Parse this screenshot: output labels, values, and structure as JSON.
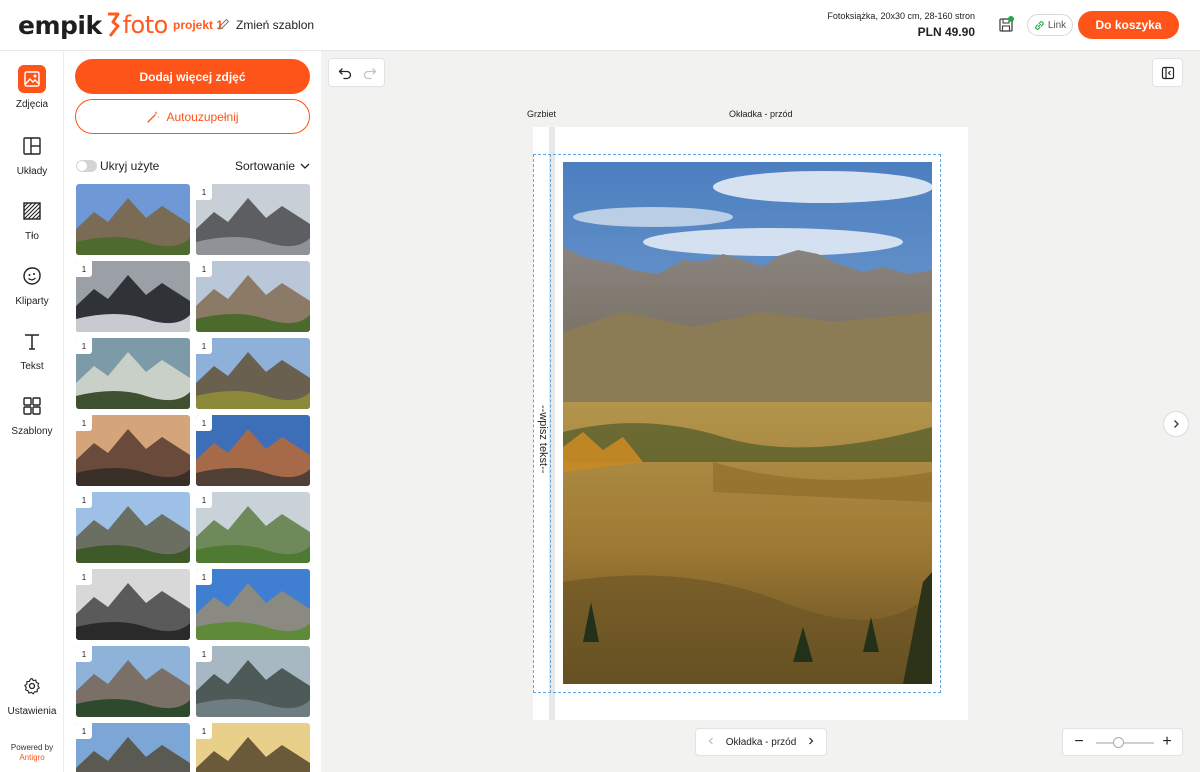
{
  "header": {
    "logo_left": "empik",
    "logo_right": "foto",
    "project_name": "projekt 1",
    "change_template": "Zmień szablon",
    "product_desc": "Fotoksiążka, 20x30 cm, 28-160 stron",
    "price": "PLN 49.90",
    "link_label": "Link",
    "cart_label": "Do koszyka"
  },
  "nav": {
    "items": [
      {
        "label": "Zdjęcia"
      },
      {
        "label": "Układy"
      },
      {
        "label": "Tło"
      },
      {
        "label": "Kliparty"
      },
      {
        "label": "Tekst"
      },
      {
        "label": "Szablony"
      }
    ],
    "settings": "Ustawienia",
    "powered_by": "Powered by",
    "powered_brand": "Antigro"
  },
  "panel": {
    "add_photos": "Dodaj więcej zdjęć",
    "autofill": "Autouzupełnij",
    "hide_used": "Ukryj użyte",
    "sort": "Sortowanie",
    "photo_counts": [
      "",
      "1",
      "1",
      "1",
      "1",
      "1",
      "1",
      "1",
      "1",
      "1",
      "1",
      "1",
      "1",
      "1",
      "1",
      "1"
    ]
  },
  "canvas": {
    "spine_label": "Grzbiet",
    "front_label": "Okładka - przód",
    "spine_text": "--wpisz tekst--",
    "pager_label": "Okładka - przód"
  },
  "colors": {
    "accent": "#ff5419",
    "guide": "#5ea6e6",
    "save_indicator": "#21a846"
  }
}
